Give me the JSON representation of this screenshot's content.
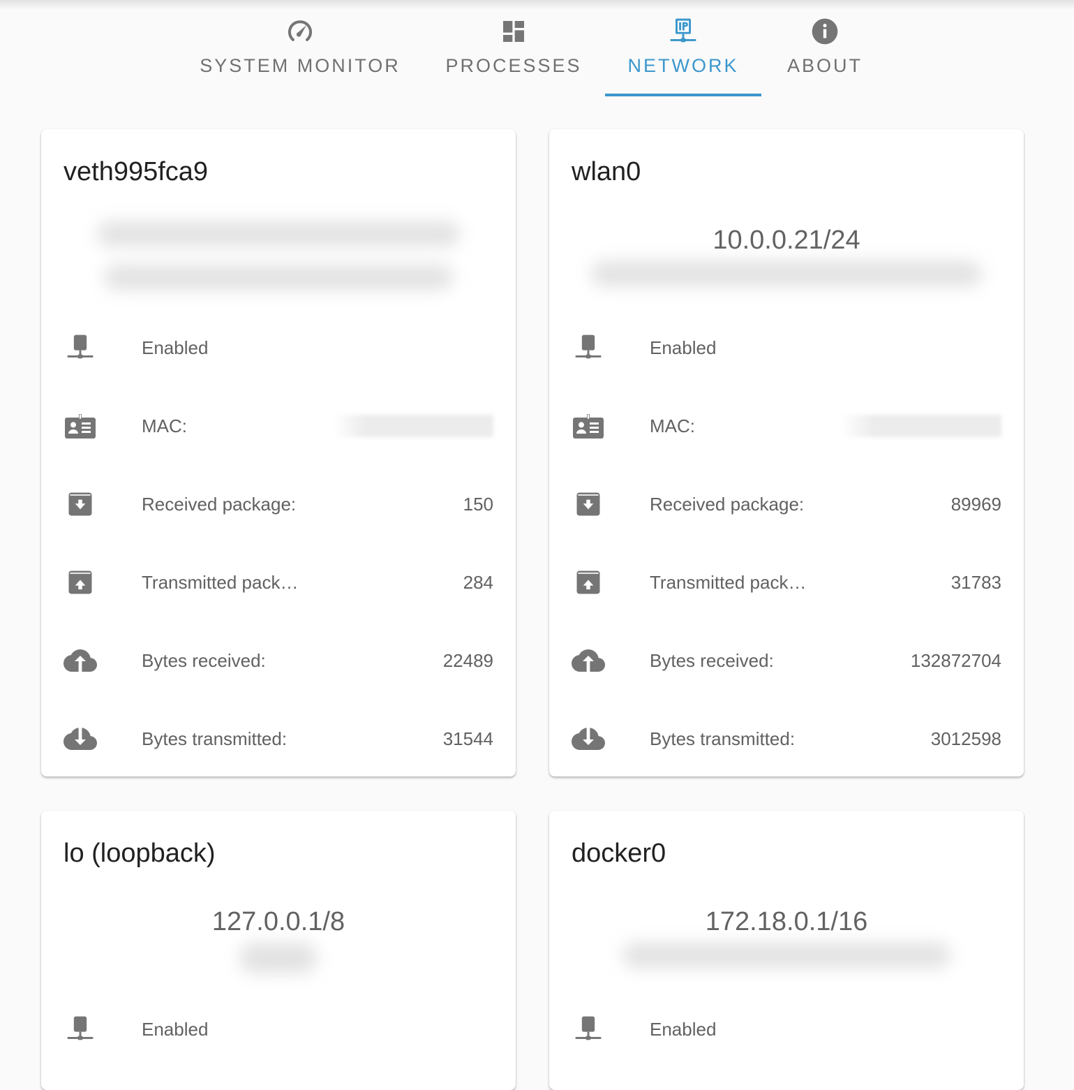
{
  "tabs": [
    {
      "label": "System Monitor",
      "icon": "speedometer-icon",
      "active": false
    },
    {
      "label": "Processes",
      "icon": "dashboard-icon",
      "active": false
    },
    {
      "label": "Network",
      "icon": "ip-network-icon",
      "active": true
    },
    {
      "label": "About",
      "icon": "info-icon",
      "active": false
    }
  ],
  "colors": {
    "accent": "#3b97cc",
    "icon": "#757575",
    "text": "#616161",
    "title": "#212121"
  },
  "interfaces": [
    {
      "name": "veth995fca9",
      "ip": "",
      "status": "Enabled",
      "mac_label": "MAC:",
      "rows": [
        {
          "label": "Received package:",
          "value": "150"
        },
        {
          "label": "Transmitted pack…",
          "value": "284"
        },
        {
          "label": "Bytes received:",
          "value": "22489"
        },
        {
          "label": "Bytes transmitted:",
          "value": "31544"
        }
      ]
    },
    {
      "name": "wlan0",
      "ip": "10.0.0.21/24",
      "status": "Enabled",
      "mac_label": "MAC:",
      "rows": [
        {
          "label": "Received package:",
          "value": "89969"
        },
        {
          "label": "Transmitted pack…",
          "value": "31783"
        },
        {
          "label": "Bytes received:",
          "value": "132872704"
        },
        {
          "label": "Bytes transmitted:",
          "value": "3012598"
        }
      ]
    },
    {
      "name": "lo (loopback)",
      "ip": "127.0.0.1/8",
      "status": "Enabled"
    },
    {
      "name": "docker0",
      "ip": "172.18.0.1/16",
      "status": "Enabled"
    }
  ]
}
